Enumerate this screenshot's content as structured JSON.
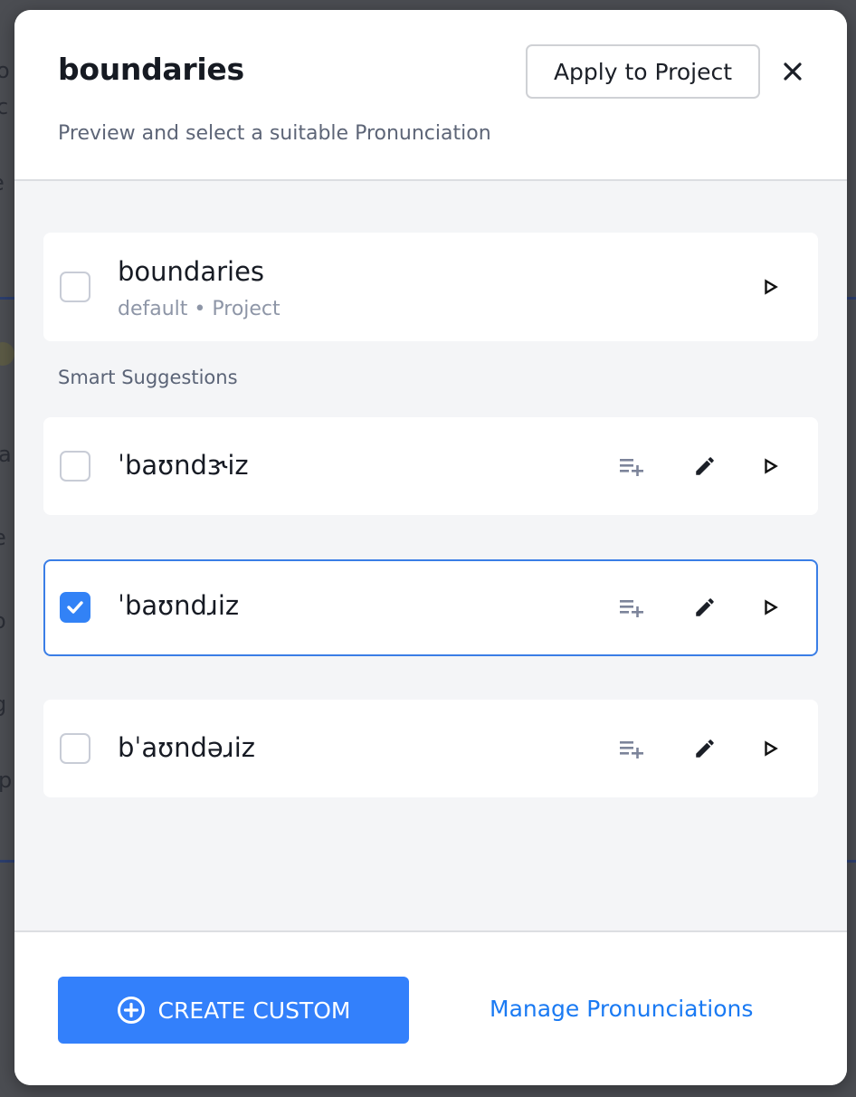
{
  "modal": {
    "title": "boundaries",
    "subtitle": "Preview and select a suitable Pronunciation",
    "apply_label": "Apply to Project",
    "close_icon": "close-icon"
  },
  "default_option": {
    "word": "boundaries",
    "meta": "default • Project",
    "checked": false,
    "icons": [
      "play-icon"
    ]
  },
  "suggestions": {
    "label": "Smart Suggestions",
    "items": [
      {
        "ipa": "ˈbaʊndɝiz",
        "checked": false,
        "icons": [
          "playlist-add-icon",
          "pencil-icon",
          "play-icon"
        ]
      },
      {
        "ipa": "ˈbaʊndɹiz",
        "checked": true,
        "icons": [
          "playlist-add-icon",
          "pencil-icon",
          "play-icon"
        ]
      },
      {
        "ipa": "bˈaʊndəɹiz",
        "checked": false,
        "icons": [
          "playlist-add-icon",
          "pencil-icon",
          "play-icon"
        ]
      }
    ]
  },
  "footer": {
    "create_label": "CREATE CUSTOM",
    "create_icon": "plus-circle-icon",
    "manage_label": "Manage Pronunciations"
  },
  "colors": {
    "accent": "#3380fb",
    "link": "#1a7af3",
    "selected_border": "#3a7ee6",
    "body_bg": "#f4f5f7"
  }
}
